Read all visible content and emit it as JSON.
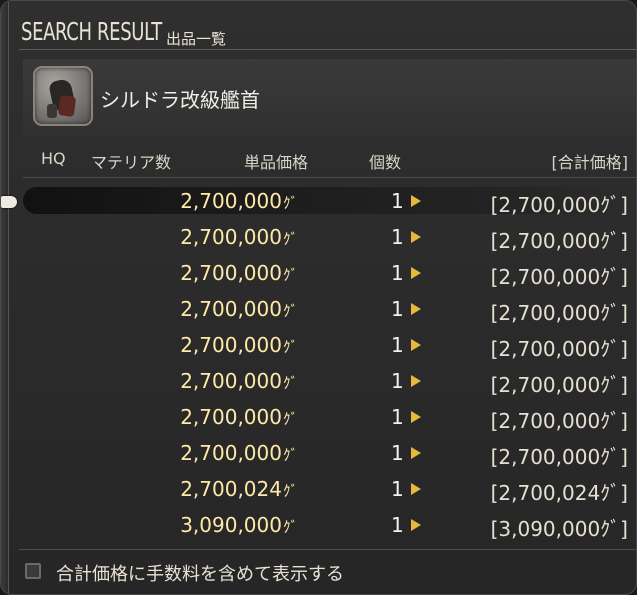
{
  "window": {
    "title": "SEARCH RESULT",
    "subtitle": "出品一覧"
  },
  "item": {
    "name": "シルドラ改級艦首",
    "icon": "ship-bow-item-icon"
  },
  "columns": {
    "hq": "HQ",
    "materia": "マテリア数",
    "unit_price": "単品価格",
    "quantity": "個数",
    "total": "[合計価格]"
  },
  "currency_symbol": "ｸﾞ",
  "listings": [
    {
      "price": "2,700,000",
      "qty": "1",
      "total": "[2,700,000ｸﾞ]"
    },
    {
      "price": "2,700,000",
      "qty": "1",
      "total": "[2,700,000ｸﾞ]"
    },
    {
      "price": "2,700,000",
      "qty": "1",
      "total": "[2,700,000ｸﾞ]"
    },
    {
      "price": "2,700,000",
      "qty": "1",
      "total": "[2,700,000ｸﾞ]"
    },
    {
      "price": "2,700,000",
      "qty": "1",
      "total": "[2,700,000ｸﾞ]"
    },
    {
      "price": "2,700,000",
      "qty": "1",
      "total": "[2,700,000ｸﾞ]"
    },
    {
      "price": "2,700,000",
      "qty": "1",
      "total": "[2,700,000ｸﾞ]"
    },
    {
      "price": "2,700,000",
      "qty": "1",
      "total": "[2,700,000ｸﾞ]"
    },
    {
      "price": "2,700,024",
      "qty": "1",
      "total": "[2,700,024ｸﾞ]"
    },
    {
      "price": "3,090,000",
      "qty": "1",
      "total": "[3,090,000ｸﾞ]"
    }
  ],
  "footer": {
    "checkbox_label": "合計価格に手数料を含めて表示する",
    "checked": false
  },
  "colors": {
    "price_text": "#ffe9a8",
    "arrow": "#e6b93e",
    "background": "#2a2a2a"
  }
}
